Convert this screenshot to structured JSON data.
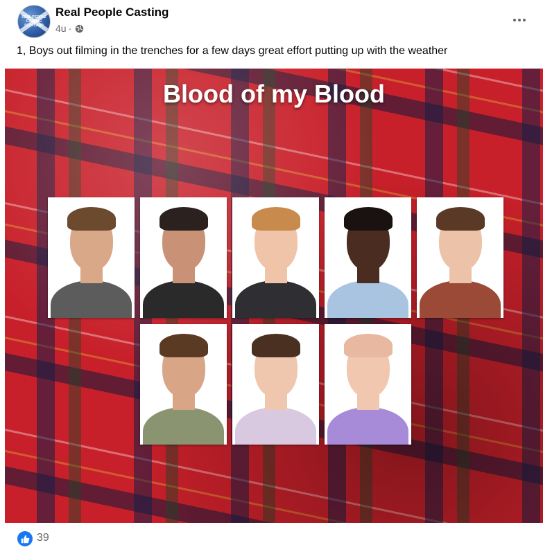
{
  "post": {
    "page_name": "Real People Casting",
    "avatar_text": "REAL PEOPLE CASTING SCOTLAND",
    "timestamp": "4u",
    "separator": "·",
    "privacy_icon": "globe-icon",
    "more_icon": "more-options-icon",
    "caption": "1, Boys out filming in the trenches for a few days great effort putting up with the weather"
  },
  "media": {
    "title": "Blood of my Blood",
    "background": "red-tartan",
    "headshots": [
      {
        "skin": "#d9a889",
        "hair": "#6b4a2e",
        "shirt": "#5c5c5c"
      },
      {
        "skin": "#c99276",
        "hair": "#2b2220",
        "shirt": "#2a2a2a"
      },
      {
        "skin": "#f0c4a8",
        "hair": "#c98a4e",
        "shirt": "#2f2f33"
      },
      {
        "skin": "#4a2d20",
        "hair": "#1a1210",
        "shirt": "#a9c4e0"
      },
      {
        "skin": "#ecc3a8",
        "hair": "#5a3a26",
        "shirt": "#9a4a36"
      },
      {
        "skin": "#d9a587",
        "hair": "#5a3a22",
        "shirt": "#8a9470"
      },
      {
        "skin": "#efc7ae",
        "hair": "#4a3020",
        "shirt": "#d8c8e0"
      },
      {
        "skin": "#f2c7b0",
        "hair": "#e8b8a0",
        "shirt": "#a88bd8"
      }
    ]
  },
  "reactions": {
    "icon": "like-icon",
    "count": "39"
  },
  "colors": {
    "accent": "#1877f2",
    "secondary_text": "#65676b",
    "tartan_red": "#c8202a"
  }
}
